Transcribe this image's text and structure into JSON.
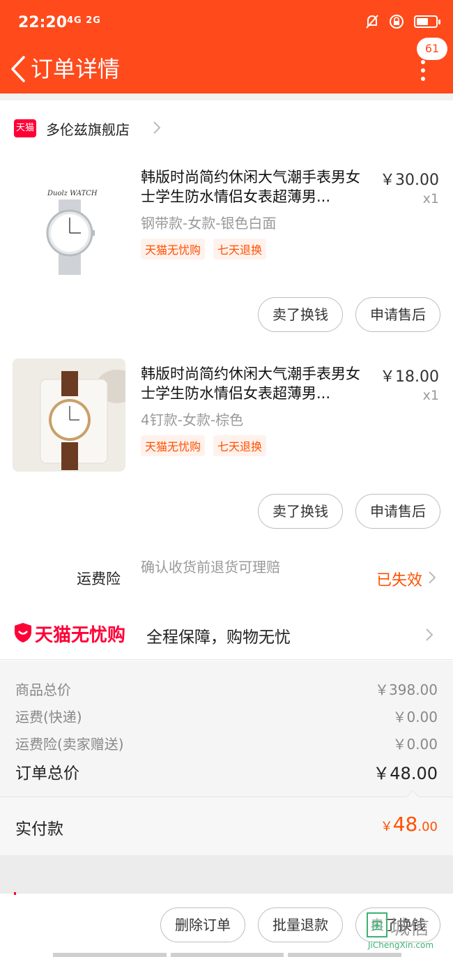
{
  "status_bar": {
    "time": "22:20",
    "network": "4G 2G"
  },
  "nav": {
    "title": "订单详情",
    "message_badge": "61"
  },
  "shop": {
    "badge_text": "天猫",
    "name": "多伦兹旗舰店"
  },
  "items": [
    {
      "title": "韩版时尚简约休闲大气潮手表男女士学生防水情侣女表超薄男...",
      "price": "￥30.00",
      "qty": "x1",
      "sku": "钢带款-女款-银色白面",
      "tags": [
        "天猫无忧购",
        "七天退换"
      ],
      "thumb_brand": "Duolz WATCH",
      "buttons": [
        "卖了换钱",
        "申请售后"
      ]
    },
    {
      "title": "韩版时尚简约休闲大气潮手表男女士学生防水情侣女表超薄男...",
      "price": "￥18.00",
      "qty": "x1",
      "sku": "4钉款-女款-棕色",
      "tags": [
        "天猫无忧购",
        "七天退换"
      ],
      "buttons": [
        "卖了换钱",
        "申请售后"
      ]
    }
  ],
  "insurance": {
    "label": "运费险",
    "desc": "确认收货前退货可理赔",
    "status": "已失效"
  },
  "wuyou": {
    "brand": "天猫无忧购",
    "slogan": "全程保障，购物无忧"
  },
  "summary": {
    "goods_label": "商品总价",
    "goods_value": "￥398.00",
    "shipping_label": "运费(快递)",
    "shipping_value": "￥0.00",
    "insurance_label": "运费险(卖家赠送)",
    "insurance_value": "￥0.00",
    "total_label": "订单总价",
    "total_value": "￥48.00"
  },
  "paid": {
    "label": "实付款",
    "currency": "￥",
    "integer": "48",
    "decimal": ".00"
  },
  "bottom_buttons": [
    "删除订单",
    "批量退款",
    "卖了换钱"
  ],
  "watermark": {
    "cn": "城信",
    "en": "JiChengXin.com"
  },
  "colors": {
    "brand_red": "#ff4a1c",
    "tmall_red": "#ff0036",
    "accent_orange": "#ff5000"
  }
}
